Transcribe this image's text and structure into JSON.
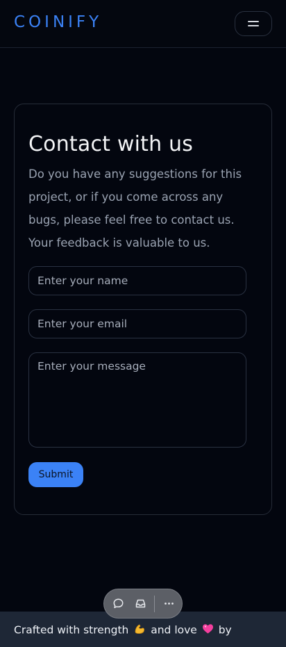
{
  "header": {
    "logo": "COINIFY",
    "menu_icon": "hamburger-icon"
  },
  "contact": {
    "title": "Contact with us",
    "description": "Do you have any suggestions for this project, or if you come across any bugs, please feel free to contact us. Your feedback is valuable to us.",
    "name_placeholder": "Enter your name",
    "email_placeholder": "Enter your email",
    "message_placeholder": "Enter your message",
    "submit_label": "Submit"
  },
  "toolbar": {
    "icons": [
      "chat-bubble-icon",
      "inbox-icon",
      "more-icon"
    ]
  },
  "footer": {
    "text_part1": "Crafted with strength",
    "text_part2": "and love",
    "text_part3": "by",
    "strength_icon": "flexed-bicep-icon",
    "love_icon": "pink-heart-icon"
  },
  "colors": {
    "accent": "#3b82f6",
    "background": "#03060f",
    "footer_bg": "#1e2736"
  }
}
